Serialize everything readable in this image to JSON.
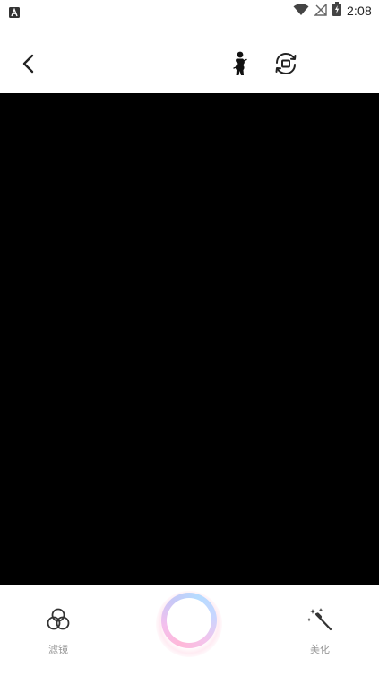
{
  "status_bar": {
    "time": "2:08",
    "notification_icon": "a-app-icon",
    "icons": [
      "wifi-icon",
      "signal-icon",
      "battery-icon"
    ]
  },
  "toolbar": {
    "back_icon": "chevron-left-icon",
    "body_icon": "body-shape-icon",
    "flip_icon": "camera-flip-icon"
  },
  "bottom": {
    "filter_label": "滤镜",
    "filter_icon": "filter-circles-icon",
    "beauty_label": "美化",
    "beauty_icon": "magic-wand-icon",
    "shutter_icon": "shutter-button"
  },
  "colors": {
    "preview_bg": "#000000",
    "label_gray": "#9a9a9a",
    "shutter_pink": "#ffb8d8",
    "shutter_blue": "#b6dcff"
  }
}
